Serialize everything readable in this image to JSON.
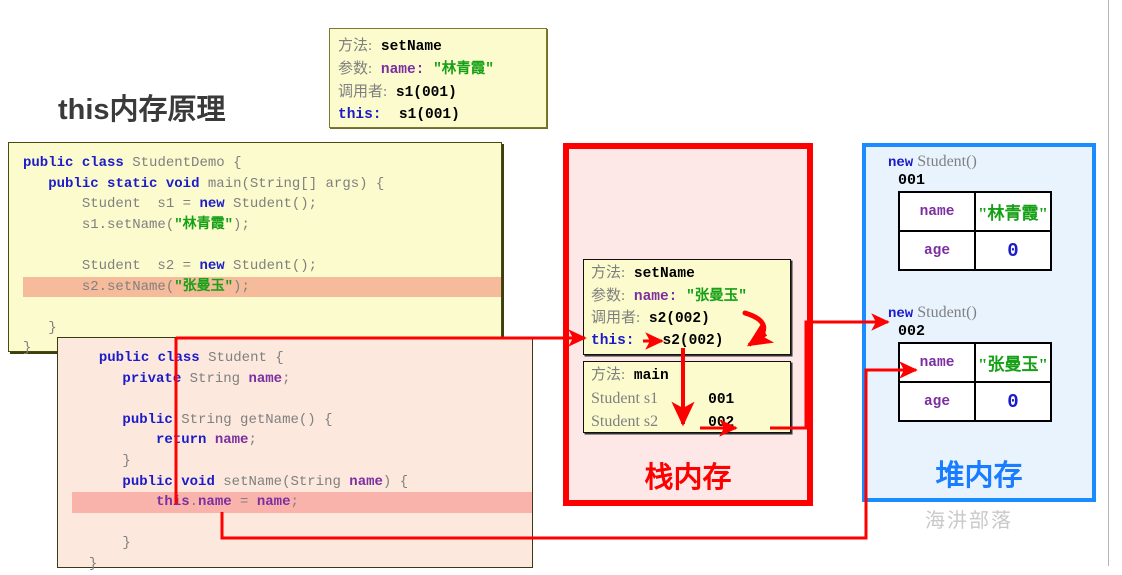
{
  "page": {
    "title": "this内存原理",
    "watermark": "海汫部落"
  },
  "top_note": {
    "method_label": "方法:",
    "method_value": "setName",
    "param_label": "参数:",
    "param_name": "name:",
    "param_value": "\"林青霞\"",
    "caller_label": "调用者:",
    "caller_value": "s1(001)",
    "this_label": "this:",
    "this_value": "s1(001)"
  },
  "code_demo": {
    "lines": [
      "public class StudentDemo {",
      "   public static void main(String[] args) {",
      "       Student s1 = new Student();",
      "       s1.setName(\"林青霞\");",
      "",
      "       Student s2 = new Student();",
      "       s2.setName(\"张曼玉\");",
      "   }",
      "}"
    ],
    "highlighted_line": "s2.setName(\"张曼玉\");"
  },
  "code_student": {
    "lines": [
      "public class Student {",
      "    private String name;",
      "",
      "    public String getName() {",
      "        return name;",
      "    }",
      "    public void setName(String name) {",
      "        this.name = name;",
      "    }",
      "}"
    ],
    "highlighted_line": "this.name = name;"
  },
  "stack": {
    "label": "栈内存",
    "color": "#ff0000",
    "frames": [
      {
        "name": "setName-frame",
        "method_label": "方法:",
        "method_value": "setName",
        "param_label": "参数:",
        "param_name": "name:",
        "param_value": "\"张曼玉\"",
        "caller_label": "调用者:",
        "caller_value": "s2(002)",
        "this_label": "this:",
        "this_value": "s2(002)"
      },
      {
        "name": "main-frame",
        "method_label": "方法:",
        "method_value": "main",
        "vars": [
          {
            "decl": "Student s1",
            "value": "001"
          },
          {
            "decl": "Student s2",
            "value": "002"
          }
        ]
      }
    ]
  },
  "heap": {
    "label": "堆内存",
    "color": "#1a7dff",
    "objects": [
      {
        "header_kw": "new",
        "header_type": "Student()",
        "address": "001",
        "fields": [
          {
            "name": "name",
            "value": "\"林青霞\"",
            "type": "string"
          },
          {
            "name": "age",
            "value": "0",
            "type": "number"
          }
        ]
      },
      {
        "header_kw": "new",
        "header_type": "Student()",
        "address": "002",
        "fields": [
          {
            "name": "name",
            "value": "\"张曼玉\"",
            "type": "string"
          },
          {
            "name": "age",
            "value": "0",
            "type": "number"
          }
        ]
      }
    ]
  }
}
